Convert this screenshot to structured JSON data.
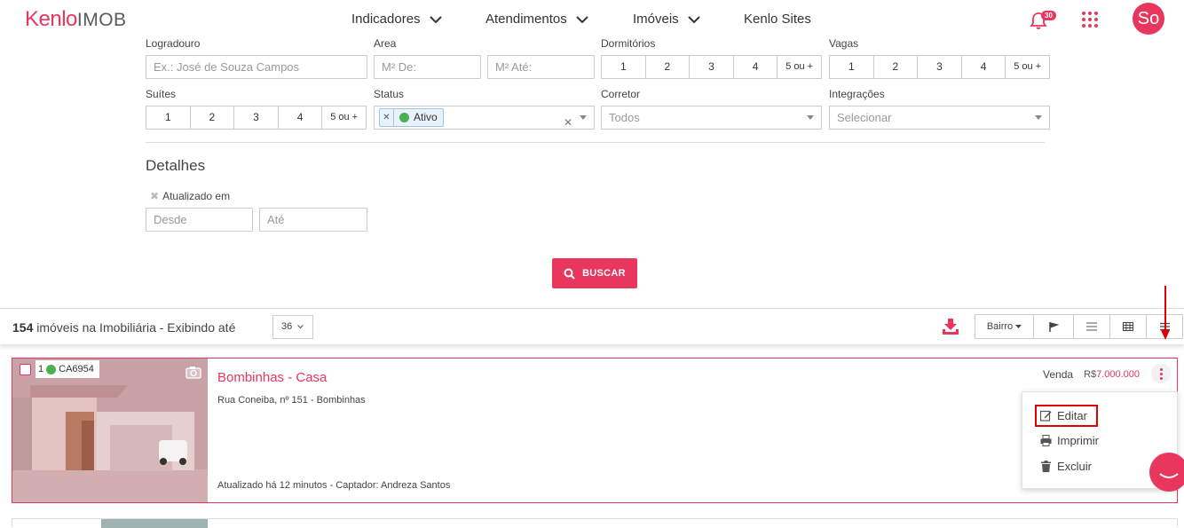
{
  "header": {
    "logo_main": "Kenlo",
    "logo_sub": "IMOB",
    "nav": [
      "Indicadores",
      "Atendimentos",
      "Imóveis",
      "Kenlo Sites"
    ],
    "notifications_count": "30",
    "avatar_initials": "So"
  },
  "filters": {
    "logradouro_label": "Logradouro",
    "logradouro_placeholder": "Ex.: José de Souza Campos",
    "area_label": "Área",
    "area_from_placeholder": "M² De:",
    "area_to_placeholder": "M² Até:",
    "dormitorios_label": "Dormitórios",
    "dormitorios_options": [
      "1",
      "2",
      "3",
      "4",
      "5 ou +"
    ],
    "vagas_label": "Vagas",
    "vagas_options": [
      "1",
      "2",
      "3",
      "4",
      "5 ou +"
    ],
    "suites_label": "Suítes",
    "suites_options": [
      "1",
      "2",
      "3",
      "4",
      "5 ou +"
    ],
    "status_label": "Status",
    "status_tag": "Ativo",
    "corretor_label": "Corretor",
    "corretor_value": "Todos",
    "integracoes_label": "Integrações",
    "integracoes_placeholder": "Selecionar",
    "detalhes_title": "Detalhes",
    "atualizado_label": "Atualizado em",
    "desde_placeholder": "Desde",
    "ate_placeholder": "Até",
    "search_button": "BUSCAR"
  },
  "results": {
    "count": "154",
    "count_text": " imóveis na Imobiliária - Exibindo até",
    "per_page": "36",
    "sort_label": "Bairro"
  },
  "listing": {
    "code_number": "1",
    "code": "CA6954",
    "title": "Bombinhas - Casa",
    "address": "Rua Coneiba, nº 151 - Bombinhas",
    "updated": "Atualizado há 12 minutos - Captador: Andreza Santos",
    "deal_type": "Venda",
    "price_currency": "R$",
    "price_value": "7.000.000"
  },
  "menu": {
    "items": [
      "Editar",
      "Imprimir",
      "Excluir"
    ]
  },
  "colors": {
    "accent": "#e8365d",
    "status_active": "#4caf50",
    "highlight": "#e00000"
  }
}
